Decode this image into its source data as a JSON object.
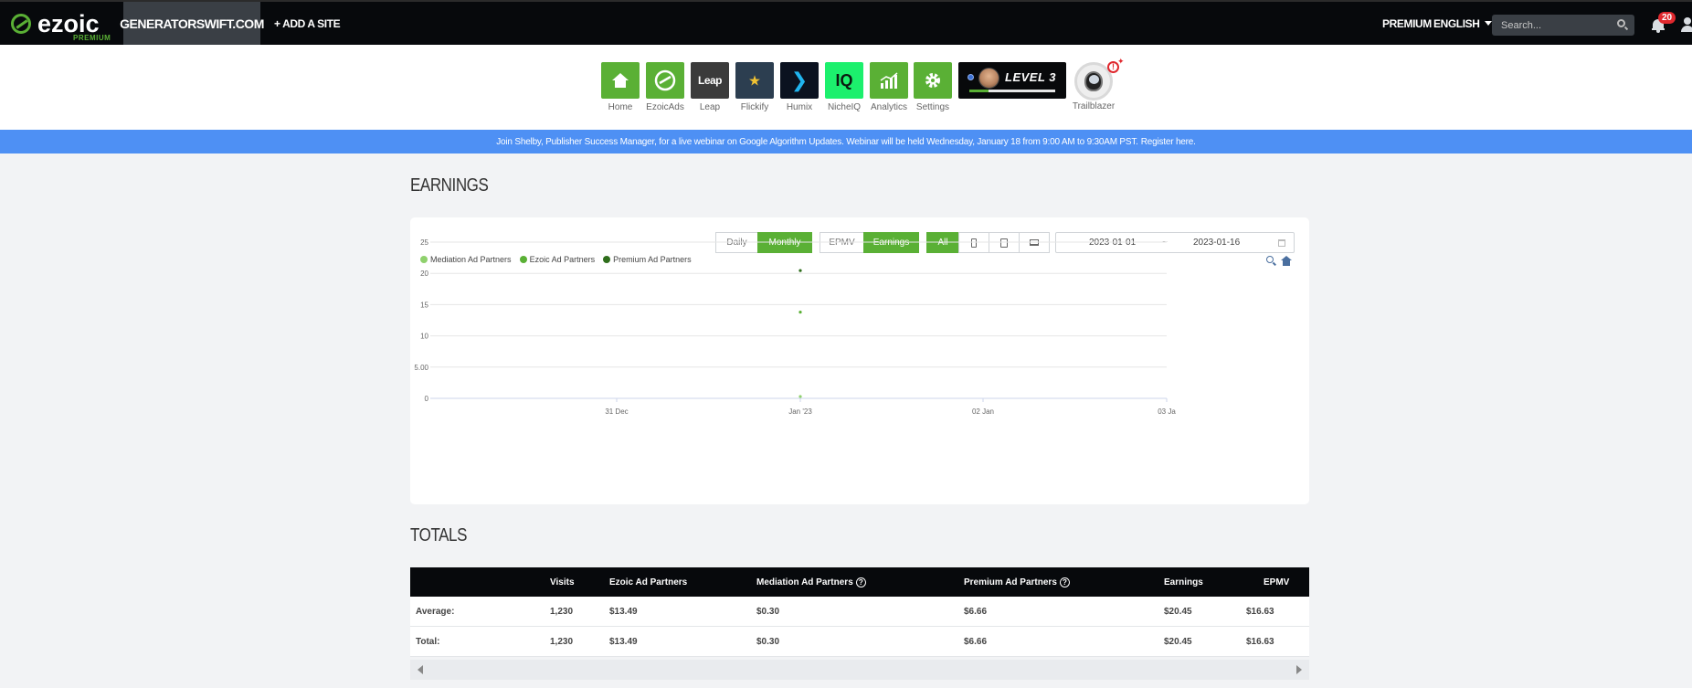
{
  "topnav": {
    "logo_text": "ezoic",
    "logo_sub": "PREMIUM",
    "site": "GENERATORSWIFT.COM",
    "add_site": "+ ADD A SITE",
    "premium": "PREMIUM",
    "language": "ENGLISH",
    "search_placeholder": "Search...",
    "notifications": "20"
  },
  "apps": [
    {
      "label": "Home",
      "color": "#5ab035",
      "icon": "home-icon"
    },
    {
      "label": "EzoicAds",
      "color": "#5ab035",
      "icon": "ezoic-ads-icon"
    },
    {
      "label": "Leap",
      "color": "#3b3b3b",
      "icon": "leap-icon",
      "glyph": "Leap"
    },
    {
      "label": "Flickify",
      "color": "#2c3e50",
      "icon": "flickify-icon",
      "glyph": "⭑"
    },
    {
      "label": "Humix",
      "color": "#0b1220",
      "icon": "humix-icon",
      "glyph": "❯"
    },
    {
      "label": "NicheIQ",
      "color": "#1cf06d",
      "icon": "nicheiq-icon",
      "glyph": "IQ"
    },
    {
      "label": "Analytics",
      "color": "#5ab035",
      "icon": "analytics-icon"
    },
    {
      "label": "Settings",
      "color": "#5ab035",
      "icon": "settings-icon"
    }
  ],
  "level": {
    "text": "LEVEL 3",
    "progress": 0.22
  },
  "trailblazer": {
    "label": "Trailblazer",
    "alert": "!"
  },
  "banner": {
    "text": "Join Shelby, Publisher Success Manager, for a live webinar on Google Algorithm Updates. Webinar will be held Wednesday, January 18 from 9:00 AM to 9:30AM PST.",
    "link": "Register here."
  },
  "earnings_heading": "EARNINGS",
  "controls": {
    "period": [
      {
        "label": "Daily",
        "active": false
      },
      {
        "label": "Monthly",
        "active": true
      }
    ],
    "metric": [
      {
        "label": "EPMV",
        "active": false
      },
      {
        "label": "Earnings",
        "active": true
      }
    ],
    "device": [
      {
        "label": "All",
        "active": true
      },
      {
        "icon": "mobile-icon"
      },
      {
        "icon": "tablet-icon"
      },
      {
        "icon": "desktop-icon"
      }
    ],
    "date_from": "2023-01-01",
    "date_sep": "~",
    "date_to": "2023-01-16"
  },
  "chart_data": {
    "type": "scatter",
    "legend": "top-left",
    "grid": true,
    "series": [
      {
        "name": "Mediation Ad Partners",
        "color": "#8fd16d",
        "points": [
          {
            "x": "Jan '23",
            "y": 0.3
          }
        ]
      },
      {
        "name": "Ezoic Ad Partners",
        "color": "#5ab035",
        "points": [
          {
            "x": "Jan '23",
            "y": 13.8
          }
        ]
      },
      {
        "name": "Premium Ad Partners",
        "color": "#2f6e1c",
        "points": [
          {
            "x": "Jan '23",
            "y": 20.45
          }
        ]
      }
    ],
    "x_ticks": [
      "31 Dec",
      "Jan '23",
      "02 Jan",
      "03 Ja"
    ],
    "y_ticks": [
      "0",
      "5.00",
      "10",
      "15",
      "20",
      "25"
    ],
    "ylim": [
      0,
      25
    ]
  },
  "totals_heading": "TOTALS",
  "table": {
    "headers": [
      "",
      "Visits",
      "Ezoic Ad Partners",
      "Mediation Ad Partners",
      "Premium Ad Partners",
      "Earnings",
      "EPMV"
    ],
    "rows": [
      [
        "Average:",
        "1,230",
        "$13.49",
        "$0.30",
        "$6.66",
        "$20.45",
        "$16.63"
      ],
      [
        "Total:",
        "1,230",
        "$13.49",
        "$0.30",
        "$6.66",
        "$20.45",
        "$16.63"
      ]
    ]
  }
}
